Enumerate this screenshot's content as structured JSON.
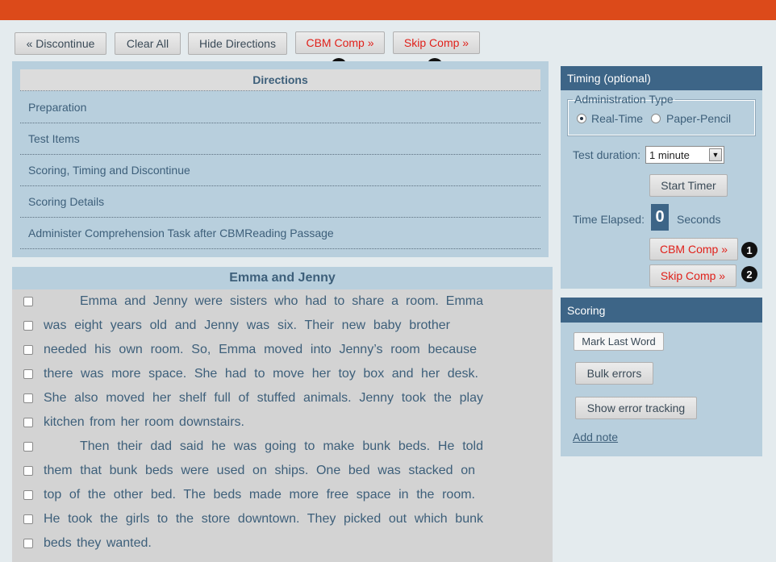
{
  "toolbar": {
    "discontinue": "« Discontinue",
    "clear_all": "Clear All",
    "hide_directions": "Hide Directions",
    "cbm_comp": "CBM Comp »",
    "skip_comp": "Skip Comp »"
  },
  "badges": {
    "one": "1",
    "two": "2"
  },
  "directions": {
    "header": "Directions",
    "items": [
      "Preparation",
      "Test Items",
      "Scoring, Timing and Discontinue",
      "Scoring Details",
      "Administer Comprehension Task after CBMReading Passage"
    ]
  },
  "passage": {
    "title": "Emma and Jenny",
    "lines": [
      "Emma and Jenny were sisters who had to share a room.  Emma",
      "was eight years old and Jenny was six.  Their new baby brother",
      "needed his own room.  So, Emma moved into Jenny’s room because",
      "there was more space.  She had to move her toy box and her desk.",
      "She also moved her shelf full of stuffed animals.  Jenny took the play",
      "kitchen from her room downstairs.",
      "Then their dad said he was going to make bunk beds.  He told",
      "them that bunk beds were used on ships.  One bed was stacked on",
      "top of the other bed.  The beds made more free space in the room.",
      "He took the girls to the store downtown.  They picked out which bunk",
      "beds they wanted."
    ]
  },
  "timing": {
    "header": "Timing (optional)",
    "admin_type_legend": "Administration Type",
    "option_realtime": "Real-Time",
    "option_paper": "Paper-Pencil",
    "selected_option": "Real-Time",
    "duration_label": "Test duration:",
    "duration_value": "1 minute",
    "start_timer": "Start Timer",
    "elapsed_label": "Time Elapsed:",
    "elapsed_value": "0",
    "elapsed_unit": "Seconds",
    "cbm_comp": "CBM Comp »",
    "skip_comp": "Skip Comp »"
  },
  "scoring": {
    "header": "Scoring",
    "mark_last_word": "Mark Last Word",
    "bulk_errors": "Bulk errors",
    "show_error_tracking": "Show error tracking",
    "add_note": "Add note"
  },
  "colors": {
    "top_bar": "#dc4a1a",
    "panel_header": "#3d6587",
    "panel_bg": "#b8cfdd",
    "passage_bg": "#d3d3d3",
    "text": "#3d5f7a",
    "red_button_text": "#e0201a"
  }
}
